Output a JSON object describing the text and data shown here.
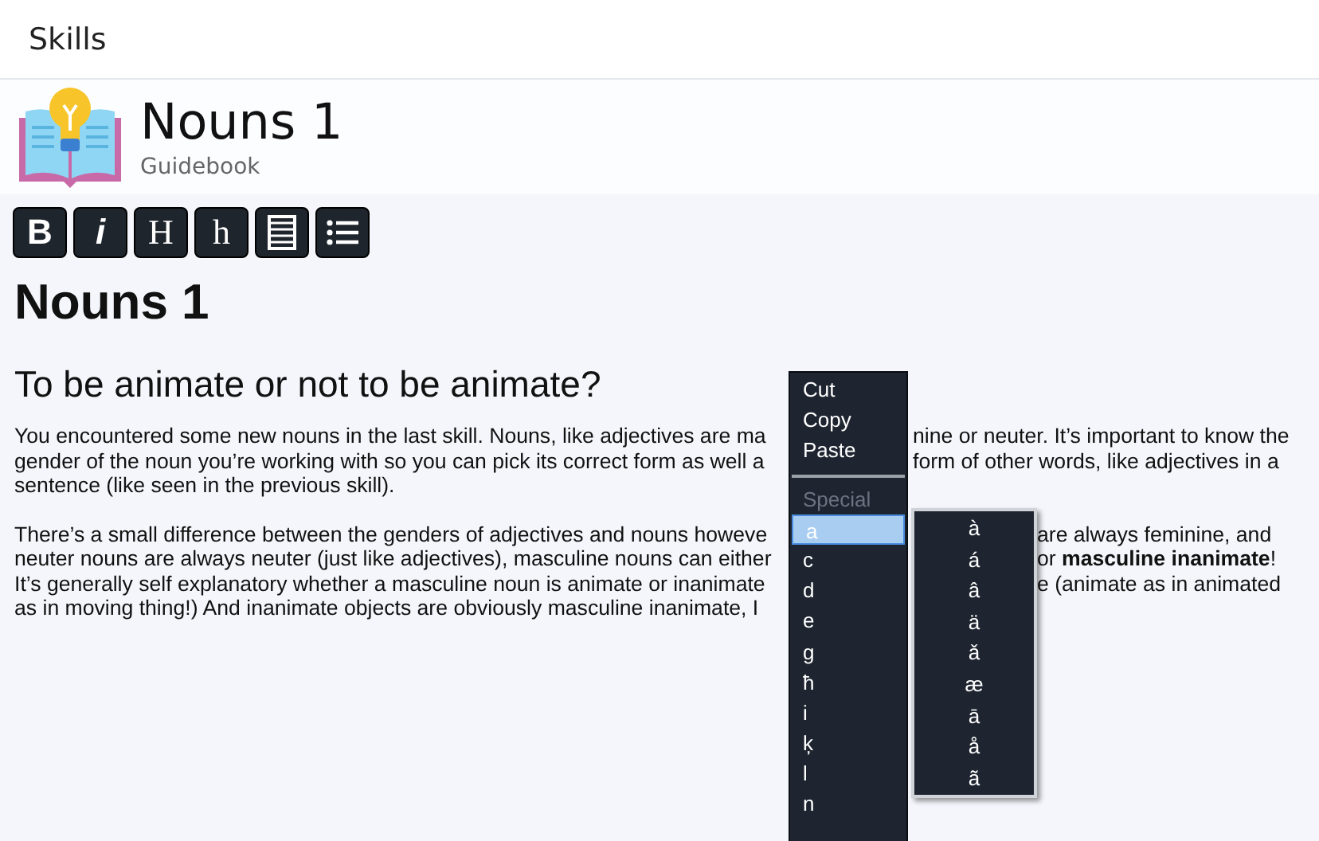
{
  "top_bar": {
    "title": "Skills"
  },
  "header": {
    "title": "Nouns 1",
    "subtitle": "Guidebook"
  },
  "toolbar": [
    {
      "kind": "text",
      "label": "B"
    },
    {
      "kind": "text",
      "label": "i"
    },
    {
      "kind": "text",
      "label": "H"
    },
    {
      "kind": "text",
      "label": "h"
    },
    {
      "kind": "icon"
    },
    {
      "kind": "icon"
    }
  ],
  "article": {
    "heading": "Nouns 1",
    "subheading": "To be animate or not to be animate?",
    "paragraphs": [
      {
        "kind": "beside_menu",
        "lines": [
          [
            "You encountered some new nouns in the last skill. Nouns, like adjectives are ma",
            "nine or neuter.  It’s important to know the"
          ],
          [
            "gender of the noun you’re working with so you can pick its correct form as well a",
            "form of other words, like adjectives in a"
          ],
          [
            "sentence (like seen in the previous skill)."
          ]
        ]
      },
      {
        "kind": "beside_submenu",
        "lines": [
          [
            "There’s a small difference between the genders of adjectives and nouns howeve",
            "are always feminine, and"
          ],
          [
            "neuter nouns are always neuter (just like adjectives), masculine nouns can either",
            "or **masculine inanimate**!"
          ],
          [
            "It’s generally self explanatory whether a masculine noun is animate or inanimate",
            "e (animate as in animated"
          ],
          [
            "as in moving thing!) And inanimate objects are obviously masculine inanimate, I"
          ]
        ]
      }
    ]
  },
  "context_menu": {
    "items": [
      {
        "kind": "item",
        "label": "Cut",
        "disabled": false,
        "selected": false
      },
      {
        "kind": "item",
        "label": "Copy",
        "disabled": false,
        "selected": false
      },
      {
        "kind": "item",
        "label": "Paste",
        "disabled": false,
        "selected": false
      },
      {
        "kind": "separator"
      },
      {
        "kind": "item",
        "label": "Special",
        "disabled": true,
        "selected": false
      },
      {
        "kind": "item",
        "label": "a",
        "disabled": false,
        "selected": true
      },
      {
        "kind": "item",
        "label": "c",
        "disabled": false,
        "selected": false
      },
      {
        "kind": "item",
        "label": "d",
        "disabled": false,
        "selected": false
      },
      {
        "kind": "item",
        "label": "e",
        "disabled": false,
        "selected": false
      },
      {
        "kind": "item",
        "label": "g",
        "disabled": false,
        "selected": false
      },
      {
        "kind": "item",
        "label": "ħ",
        "disabled": false,
        "selected": false
      },
      {
        "kind": "item",
        "label": "i",
        "disabled": false,
        "selected": false
      },
      {
        "kind": "item",
        "label": "ķ",
        "disabled": false,
        "selected": false
      },
      {
        "kind": "item",
        "label": "l",
        "disabled": false,
        "selected": false
      },
      {
        "kind": "item",
        "label": "n",
        "disabled": false,
        "selected": false
      }
    ],
    "submenu": [
      "à",
      "á",
      "â",
      "ä",
      "ǎ",
      "æ",
      "ā",
      "å",
      "ã"
    ]
  }
}
